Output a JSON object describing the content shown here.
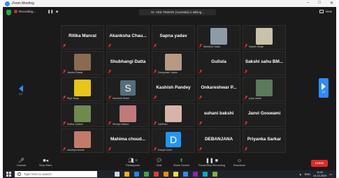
{
  "window": {
    "title": "Zoom Meeting"
  },
  "topbar": {
    "recording_label": "Recording...",
    "talking_label": "Dr. VED TEWARI (Australia) is talking...",
    "view_label": "View"
  },
  "paging": {
    "prev_page": "1/2",
    "next_page": "1/2"
  },
  "gallery": [
    {
      "name": "Ritika Manral",
      "label": "",
      "type": "name"
    },
    {
      "name": "Akanksha Chau...",
      "label": "",
      "type": "name"
    },
    {
      "name": "Sapna yadav",
      "label": "",
      "type": "name"
    },
    {
      "name": "",
      "label": "Manisha Yadav",
      "type": "photo",
      "color": "#8d9aa8"
    },
    {
      "name": "",
      "label": "Saachi Singh",
      "type": "photo",
      "color": "#c9c2a8"
    },
    {
      "name": "",
      "label": "Varsha Rawat",
      "type": "photo",
      "color": "#8a6b4f"
    },
    {
      "name": "Shubhangi Datta",
      "label": "",
      "type": "name"
    },
    {
      "name": "",
      "label": "Deepanshi Yadav",
      "type": "photo",
      "color": "#b89a82"
    },
    {
      "name": "Gulista",
      "label": "",
      "type": "name"
    },
    {
      "name": "Sakshi sahu BM...",
      "label": "",
      "type": "name"
    },
    {
      "name": "",
      "label": "Riya Singh",
      "type": "photo",
      "color": "#e6c61a"
    },
    {
      "name": "",
      "label": "Sanskriti Shahi",
      "type": "avatar-s",
      "letter": "S"
    },
    {
      "name": "Kashish Pandey",
      "label": "",
      "type": "name"
    },
    {
      "name": "Onkareshwar P...",
      "label": "",
      "type": "name"
    },
    {
      "name": "",
      "label": "priya rawat",
      "type": "photo",
      "color": "#5a7a5a"
    },
    {
      "name": "",
      "label": "Kritika Gadkot",
      "type": "photo",
      "color": "#6f8a4d"
    },
    {
      "name": "",
      "label": "Shreya Mathur",
      "type": "photo",
      "color": "#c07a7a"
    },
    {
      "name": "",
      "label": "Vaibhavi",
      "type": "photo",
      "color": "#d8b4a8"
    },
    {
      "name": "suhani bakshi",
      "label": "",
      "type": "name"
    },
    {
      "name": "Janvi Goswami",
      "label": "",
      "type": "name"
    },
    {
      "name": "",
      "label": "sandhya kumari",
      "type": "photo",
      "color": "#c47a6a"
    },
    {
      "name": "Mahima choud...",
      "label": "",
      "type": "name"
    },
    {
      "name": "",
      "label": "Deepti Joshi",
      "type": "avatar-d",
      "letter": "D"
    },
    {
      "name": "DEBANJANA",
      "label": "",
      "type": "name"
    },
    {
      "name": "Priyanka Sarkar",
      "label": "",
      "type": "name"
    }
  ],
  "toolbar": {
    "unmute": "Unmute",
    "stop_video": "Stop Video",
    "participants": "Participants",
    "participants_count": "72",
    "chat": "Chat",
    "share_screen": "Share Screen",
    "pause_recording": "Pause/Stop Recording",
    "reactions": "Reactions",
    "leave": "Leave"
  },
  "taskbar": {
    "search_placeholder": "Type here to search",
    "lang": "ENG",
    "time": "11:41",
    "date": "14-12-2020"
  },
  "colors": {
    "accent": "#2d8cff",
    "danger": "#e02828",
    "share": "#27a844"
  }
}
